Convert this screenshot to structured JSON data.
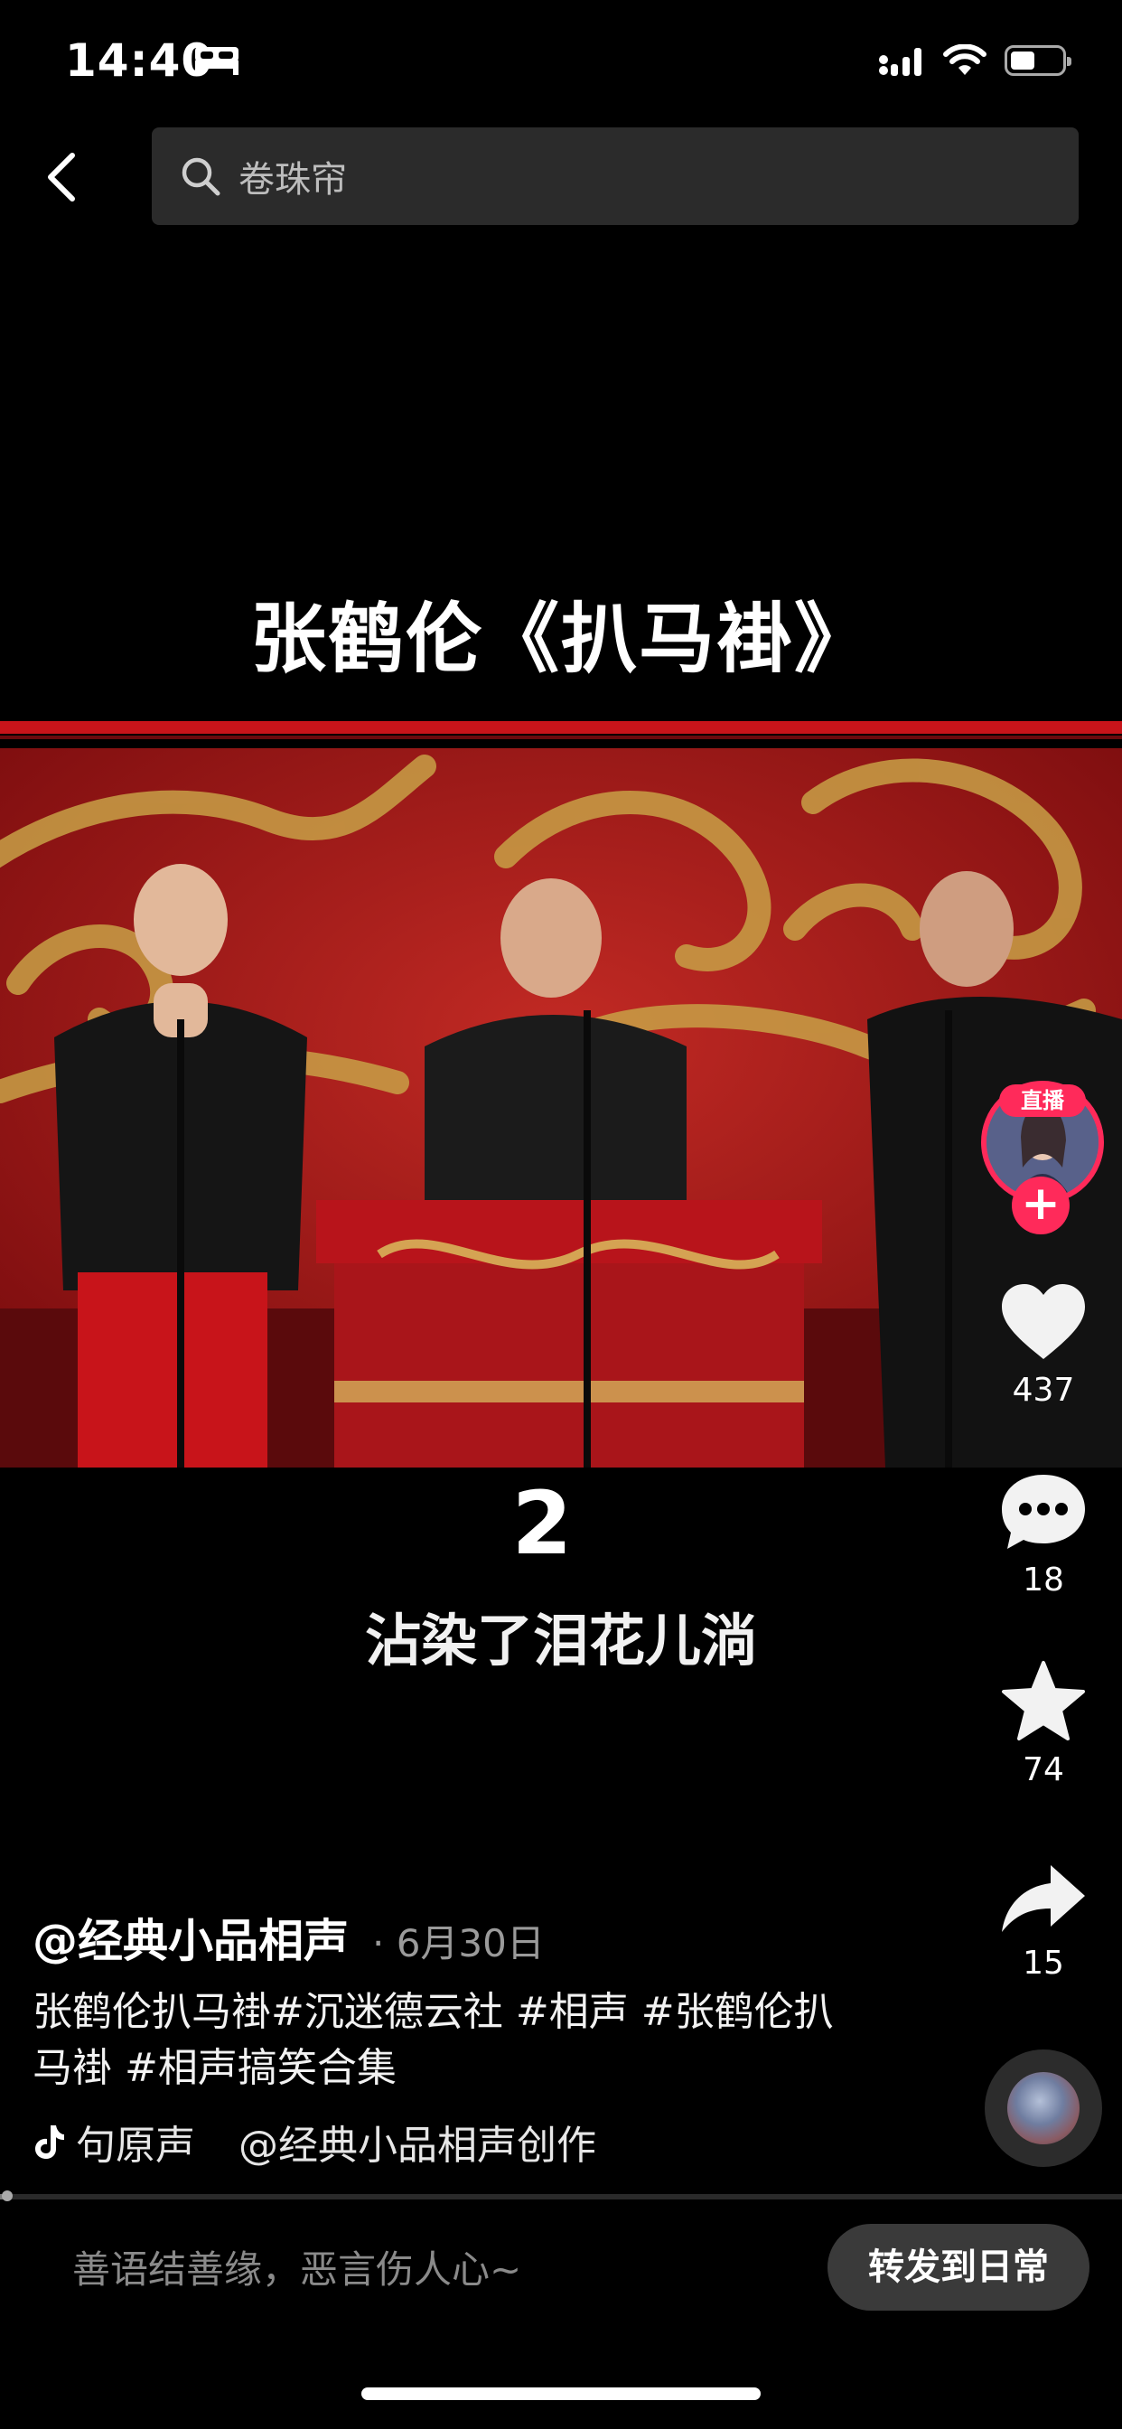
{
  "status": {
    "time": "14:40"
  },
  "search": {
    "query": "卷珠帘"
  },
  "video": {
    "title": "张鹤伦《扒马褂》",
    "subtitle_number": "2",
    "subtitle_text": "沾染了泪花儿淌"
  },
  "rail": {
    "live_label": "直播",
    "likes": "437",
    "comments": "18",
    "favorites": "74",
    "shares": "15"
  },
  "caption": {
    "author": "@经典小品相声",
    "date": "· 6月30日",
    "description": "张鹤伦扒马褂#沉迷德云社 #相声 #张鹤伦扒马褂 #相声搞笑合集",
    "music_prefix": "句原声",
    "music_credit": "@经典小品相声创作"
  },
  "progress": {
    "fraction": 0.005
  },
  "bottom": {
    "comment_placeholder": "善语结善缘，恶言伤人心~",
    "share_button": "转发到日常"
  },
  "colors": {
    "accent": "#ff2a5a",
    "background": "#000000",
    "stage_red": "#a8171c",
    "search_bg": "#2b2b2b"
  }
}
